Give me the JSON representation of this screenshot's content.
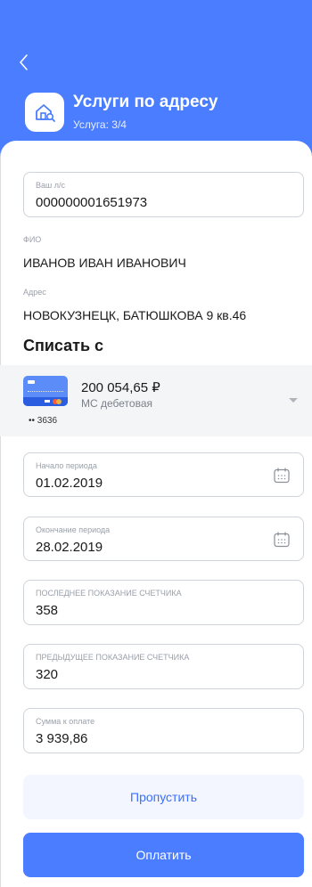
{
  "header": {
    "title": "Услуги по адресу",
    "subtitle": "Услуга: 3/4"
  },
  "account_field": {
    "label": "Ваш л/с",
    "value": "000000001651973"
  },
  "fio": {
    "label": "ФИО",
    "value": "ИВАНОВ ИВАН ИВАНОВИЧ"
  },
  "address": {
    "label": "Адрес",
    "value": "НОВОКУЗНЕЦК, БАТЮШКОВА 9 кв.46"
  },
  "debit": {
    "title": "Списать с",
    "amount": "200 054,65 ₽",
    "type": "МС дебетовая",
    "card_number": "•• 3636"
  },
  "period_start": {
    "label": "Начало периода",
    "value": "01.02.2019"
  },
  "period_end": {
    "label": "Окончание периода",
    "value": "28.02.2019"
  },
  "last_reading": {
    "label": "ПОСЛЕДНЕЕ ПОКАЗАНИЕ СЧЕТЧИКА",
    "value": "358"
  },
  "prev_reading": {
    "label": "ПРЕДЫДУЩЕЕ ПОКАЗАНИЕ СЧЕТЧИКА",
    "value": "320"
  },
  "amount_due": {
    "label": "Сумма к оплате",
    "value": "3 939,86"
  },
  "buttons": {
    "skip": "Пропустить",
    "pay": "Оплатить"
  },
  "colors": {
    "primary": "#4a7dff",
    "skip_bg": "#f3f6fe"
  },
  "icons": {
    "back": "chevron-left-icon",
    "service": "house-search-icon",
    "calendar": "calendar-icon",
    "dropdown": "caret-down-icon"
  }
}
